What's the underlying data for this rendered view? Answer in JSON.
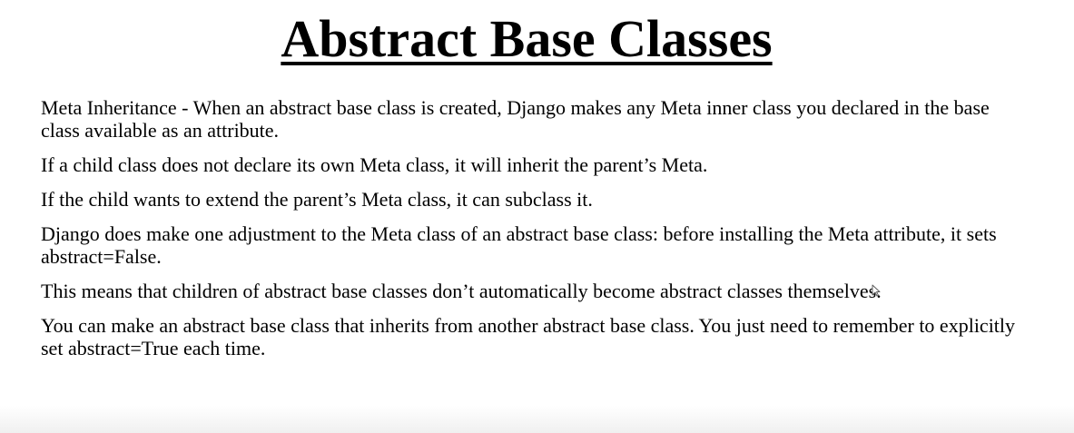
{
  "slide": {
    "title": "Abstract Base Classes",
    "paragraphs": [
      "Meta Inheritance - When an abstract base class is created, Django makes any Meta inner class you declared in the base class available as an attribute.",
      "If a child class does not declare its own Meta class, it will inherit the parent’s Meta.",
      "If the child wants to extend the parent’s Meta class, it can subclass it.",
      "Django does make one adjustment to the Meta class of an abstract base class: before installing the Meta attribute, it sets abstract=False.",
      "This means that children of abstract base classes don’t automatically become abstract classes themselves.",
      "You can make an abstract base class that inherits from another abstract base class. You just need to remember to explicitly set abstract=True each time."
    ]
  },
  "icons": {
    "cursor": "mouse-pointer-icon"
  }
}
